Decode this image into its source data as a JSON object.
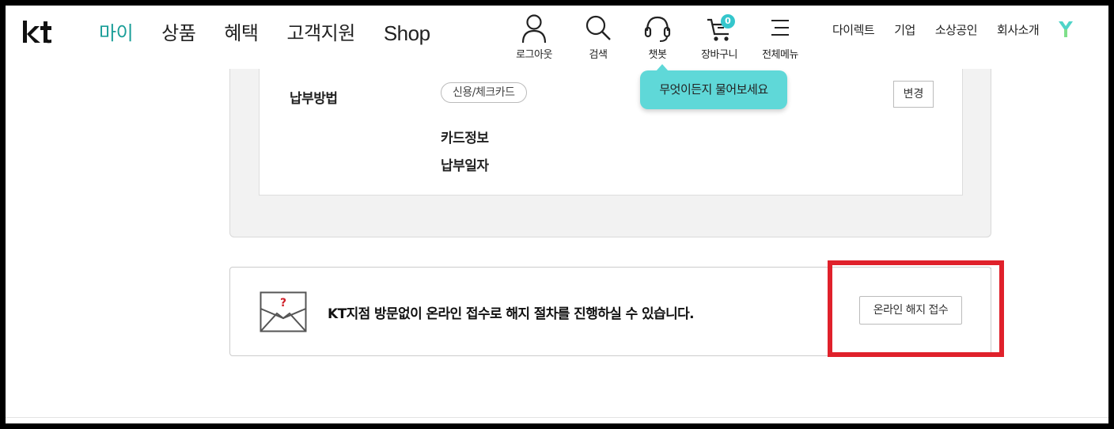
{
  "header": {
    "logo_text": "kt",
    "nav": [
      {
        "label": "마이",
        "active": true
      },
      {
        "label": "상품",
        "active": false
      },
      {
        "label": "혜택",
        "active": false
      },
      {
        "label": "고객지원",
        "active": false
      },
      {
        "label": "Shop",
        "active": false
      }
    ],
    "utility": {
      "logout": "로그아웃",
      "search": "검색",
      "chatbot": "챗봇",
      "cart": "장바구니",
      "cart_count": "0",
      "menu": "전체메뉴"
    },
    "toplinks": [
      "다이렉트",
      "기업",
      "소상공인",
      "회사소개"
    ],
    "chat_tooltip": "무엇이든지 물어보세요"
  },
  "payment": {
    "method_label": "납부방법",
    "method_value": "신용/체크카드",
    "change_button": "변경",
    "card_info_label": "카드정보",
    "pay_date_label": "납부일자"
  },
  "cancel_banner": {
    "icon_mark": "?",
    "message": "KT지점 방문없이 온라인 접수로 해지 절차를 진행하실 수 있습니다.",
    "button": "온라인 해지 접수"
  },
  "colors": {
    "accent": "#1a9e98",
    "tooltip": "#5fd8d8",
    "highlight": "#e0212b"
  }
}
